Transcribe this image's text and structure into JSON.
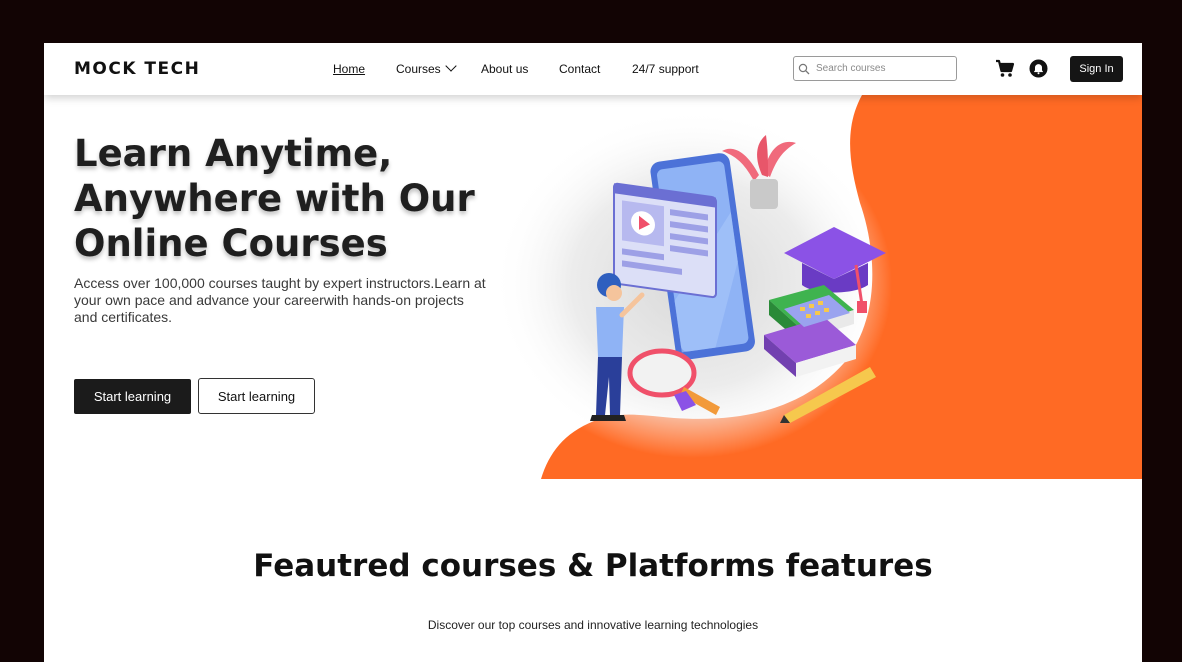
{
  "header": {
    "logo": "MOCK TECH",
    "nav": [
      {
        "label": "Home",
        "active": true
      },
      {
        "label": "Courses",
        "dropdown": true
      },
      {
        "label": "About us"
      },
      {
        "label": "Contact"
      },
      {
        "label": "24/7 support"
      }
    ],
    "search": {
      "placeholder": "Search courses",
      "value": "",
      "icon": "search-icon"
    },
    "icons": [
      "cart-icon",
      "bell-icon"
    ],
    "signin_label": "Sign In"
  },
  "hero": {
    "title": "Learn Anytime,\nAnywhere with Our\nOnline  Courses",
    "subtitle": "Access over 100,000 courses taught by expert instructors.Learn at\nyour own pace and advance your careerwith hands-on projects\n and certificates.",
    "primary_button": "Start learning",
    "secondary_button": "Start learning",
    "illustration": "e-learning-illustration"
  },
  "featured": {
    "title": "Feautred courses & Platforms features",
    "subtitle": "Discover our top courses and innovative learning technologies"
  },
  "colors": {
    "background": "#120404",
    "accent": "#ff6a24",
    "dark": "#1b1b1b",
    "page": "#ffffff"
  }
}
